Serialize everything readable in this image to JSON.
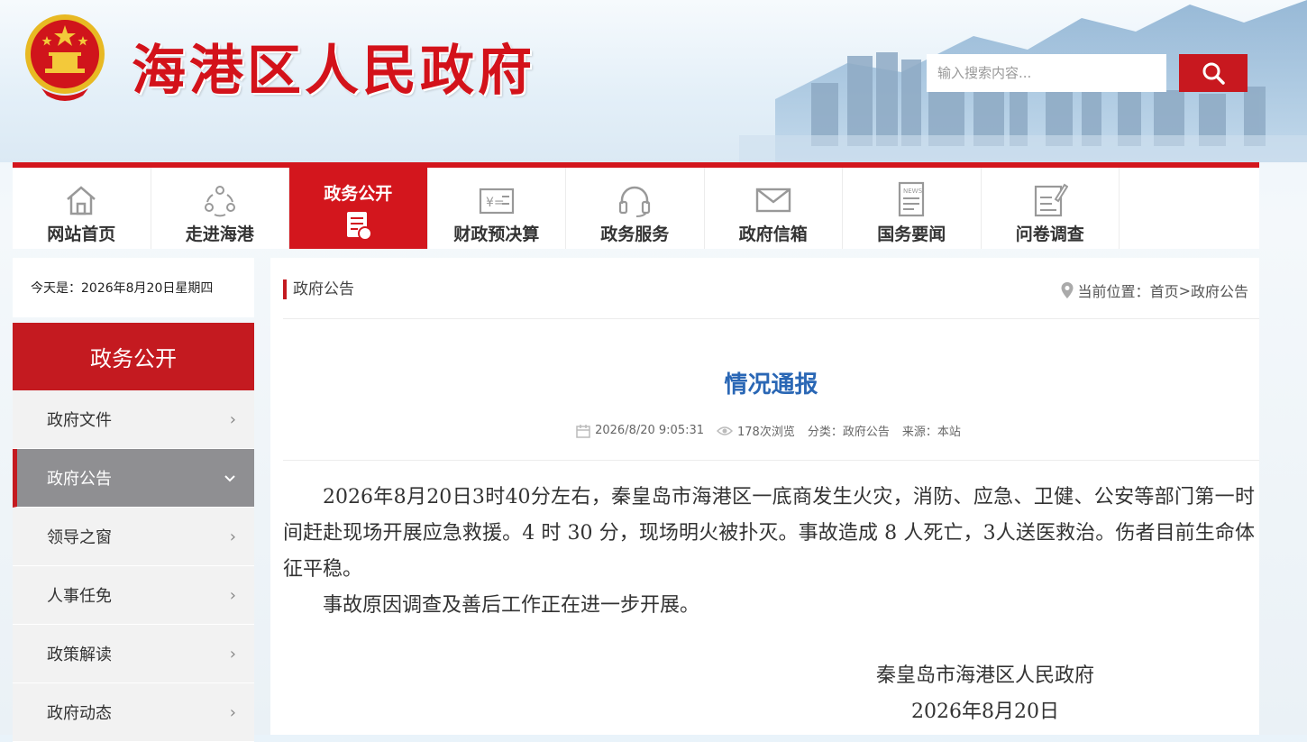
{
  "header": {
    "site_title": "海港区人民政府",
    "search_placeholder": "输入搜索内容..."
  },
  "nav": {
    "items": [
      {
        "label": "网站首页",
        "icon": "home-icon"
      },
      {
        "label": "走进海港",
        "icon": "people-network-icon"
      },
      {
        "label": "政务公开",
        "icon": "document-icon",
        "active": true
      },
      {
        "label": "财政预决算",
        "icon": "finance-icon"
      },
      {
        "label": "政务服务",
        "icon": "headset-icon"
      },
      {
        "label": "政府信箱",
        "icon": "mail-icon"
      },
      {
        "label": "国务要闻",
        "icon": "news-icon"
      },
      {
        "label": "问卷调查",
        "icon": "survey-icon"
      }
    ]
  },
  "sidebar": {
    "date_text": "今天是：2026年8月20日星期四",
    "header": "政务公开",
    "items": [
      {
        "label": "政府文件",
        "active": false
      },
      {
        "label": "政府公告",
        "active": true
      },
      {
        "label": "领导之窗",
        "active": false
      },
      {
        "label": "人事任免",
        "active": false
      },
      {
        "label": "政策解读",
        "active": false
      },
      {
        "label": "政府动态",
        "active": false
      }
    ]
  },
  "breadcrumb": {
    "section": "政府公告",
    "location_label": "当前位置：",
    "home": "首页",
    "sep": ">",
    "current": "政府公告"
  },
  "article": {
    "title": "情况通报",
    "date": "2026/8/20 9:05:31",
    "views": "178次浏览",
    "category": "分类：政府公告",
    "source": "来源：本站",
    "paragraphs": [
      "2026年8月20日3时40分左右，秦皇岛市海港区一底商发生火灾，消防、应急、卫健、公安等部门第一时间赶赴现场开展应急救援。4 时 30 分，现场明火被扑灭。事故造成 8 人死亡，3人送医救治。伤者目前生命体征平稳。",
      "事故原因调查及善后工作正在进一步开展。"
    ],
    "signature": "秦皇岛市海港区人民政府",
    "sign_date": "2026年8月20日"
  },
  "colors": {
    "brand_red": "#d3161d",
    "title_blue": "#2a67b5",
    "sidebar_active": "#8f8f92"
  }
}
